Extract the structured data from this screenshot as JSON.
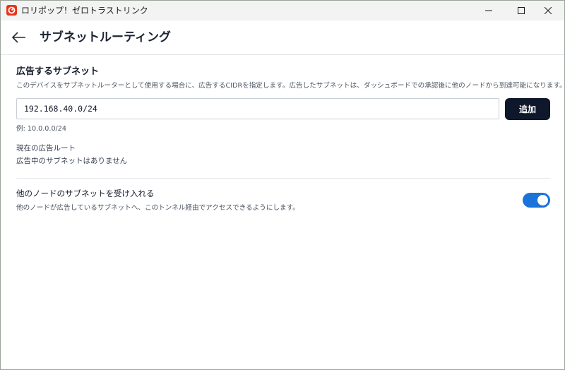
{
  "window": {
    "title": "ロリポップ！ゼロトラストリンク",
    "app_icon": "lollipop-app-icon",
    "controls": {
      "minimize_icon": "minimize-icon",
      "maximize_icon": "maximize-icon",
      "close_icon": "close-icon"
    }
  },
  "header": {
    "back_icon": "arrow-left-icon",
    "title": "サブネットルーティング"
  },
  "advertise": {
    "title": "広告するサブネット",
    "description": "このデバイスをサブネットルーターとして使用する場合に、広告するCIDRを指定します。広告したサブネットは、ダッシュボードでの承認後に他のノードから到達可能になります。",
    "input_value": "192.168.40.0/24",
    "add_button": "追加",
    "example": "例: 10.0.0.0/24",
    "current_routes_label": "現在の広告ルート",
    "current_routes_empty": "広告中のサブネットはありません"
  },
  "accept": {
    "title": "他のノードのサブネットを受け入れる",
    "description": "他のノードが広告しているサブネットへ、このトンネル経由でアクセスできるようにします。",
    "enabled": true
  },
  "colors": {
    "accent": "#1a73d9",
    "button_dark": "#0f172a",
    "app_icon_red": "#e8341c"
  }
}
